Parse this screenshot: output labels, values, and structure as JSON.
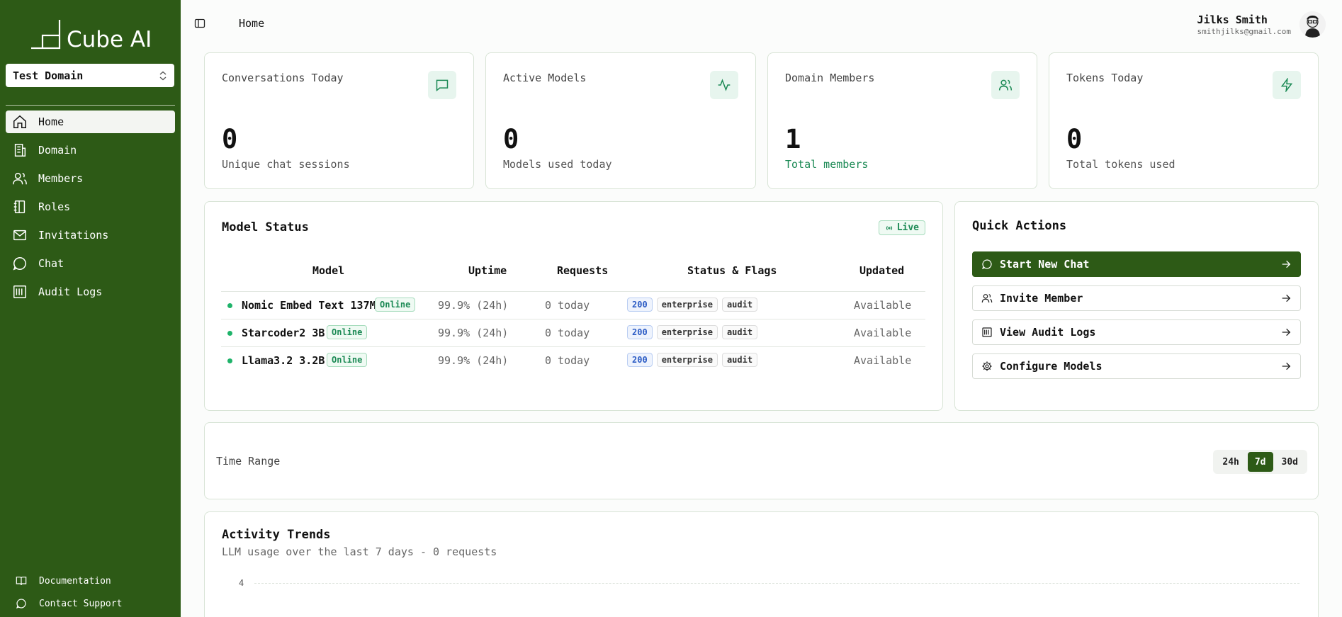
{
  "app": {
    "name": "Cube AI"
  },
  "domain_select": {
    "value": "Test Domain"
  },
  "nav": [
    {
      "label": "Home",
      "icon": "home-icon",
      "active": true
    },
    {
      "label": "Domain",
      "icon": "building-icon"
    },
    {
      "label": "Members",
      "icon": "users-icon"
    },
    {
      "label": "Roles",
      "icon": "notebook-icon"
    },
    {
      "label": "Invitations",
      "icon": "mail-icon"
    },
    {
      "label": "Chat",
      "icon": "chat-icon"
    },
    {
      "label": "Audit Logs",
      "icon": "logs-icon"
    }
  ],
  "footer": [
    {
      "label": "Documentation",
      "icon": "book-icon"
    },
    {
      "label": "Contact Support",
      "icon": "chat-icon"
    }
  ],
  "breadcrumb": "Home",
  "user": {
    "name": "Jilks Smith",
    "email": "smithjilks@gmail.com"
  },
  "stats": [
    {
      "title": "Conversations Today",
      "value": "0",
      "sub": "Unique chat sessions",
      "icon": "message-square-icon"
    },
    {
      "title": "Active Models",
      "value": "0",
      "sub": "Models used today",
      "icon": "activity-icon"
    },
    {
      "title": "Domain Members",
      "value": "1",
      "sub": "Total members",
      "icon": "users-icon"
    },
    {
      "title": "Tokens Today",
      "value": "0",
      "sub": "Total tokens used",
      "icon": "zap-icon"
    }
  ],
  "model_status": {
    "title": "Model Status",
    "live": "Live",
    "headers": [
      "Model",
      "Uptime",
      "Requests",
      "Status & Flags",
      "Updated"
    ],
    "rows": [
      {
        "model": "Nomic Embed Text 137M",
        "status": "Online",
        "uptime": "99.9% (24h)",
        "requests": "0 today",
        "flags": [
          "200",
          "enterprise",
          "audit"
        ],
        "updated": "Available"
      },
      {
        "model": "Starcoder2 3B",
        "status": "Online",
        "uptime": "99.9% (24h)",
        "requests": "0 today",
        "flags": [
          "200",
          "enterprise",
          "audit"
        ],
        "updated": "Available"
      },
      {
        "model": "Llama3.2 3.2B",
        "status": "Online",
        "uptime": "99.9% (24h)",
        "requests": "0 today",
        "flags": [
          "200",
          "enterprise",
          "audit"
        ],
        "updated": "Available"
      }
    ]
  },
  "quick_actions": {
    "title": "Quick Actions",
    "items": [
      {
        "label": "Start New Chat",
        "icon": "chat-icon"
      },
      {
        "label": "Invite Member",
        "icon": "users-icon"
      },
      {
        "label": "View Audit Logs",
        "icon": "logs-icon"
      },
      {
        "label": "Configure Models",
        "icon": "gear-icon"
      }
    ]
  },
  "time_range": {
    "label": "Time Range",
    "options": [
      "24h",
      "7d",
      "30d"
    ],
    "selected": "7d"
  },
  "activity": {
    "title": "Activity Trends",
    "subtitle": "LLM usage over the last 7 days - 0 requests",
    "y_tick": "4"
  },
  "colors": {
    "sidebar": "#2d5a16",
    "accent_green": "#1c8a55",
    "badge_blue": "#2c5cc5"
  }
}
